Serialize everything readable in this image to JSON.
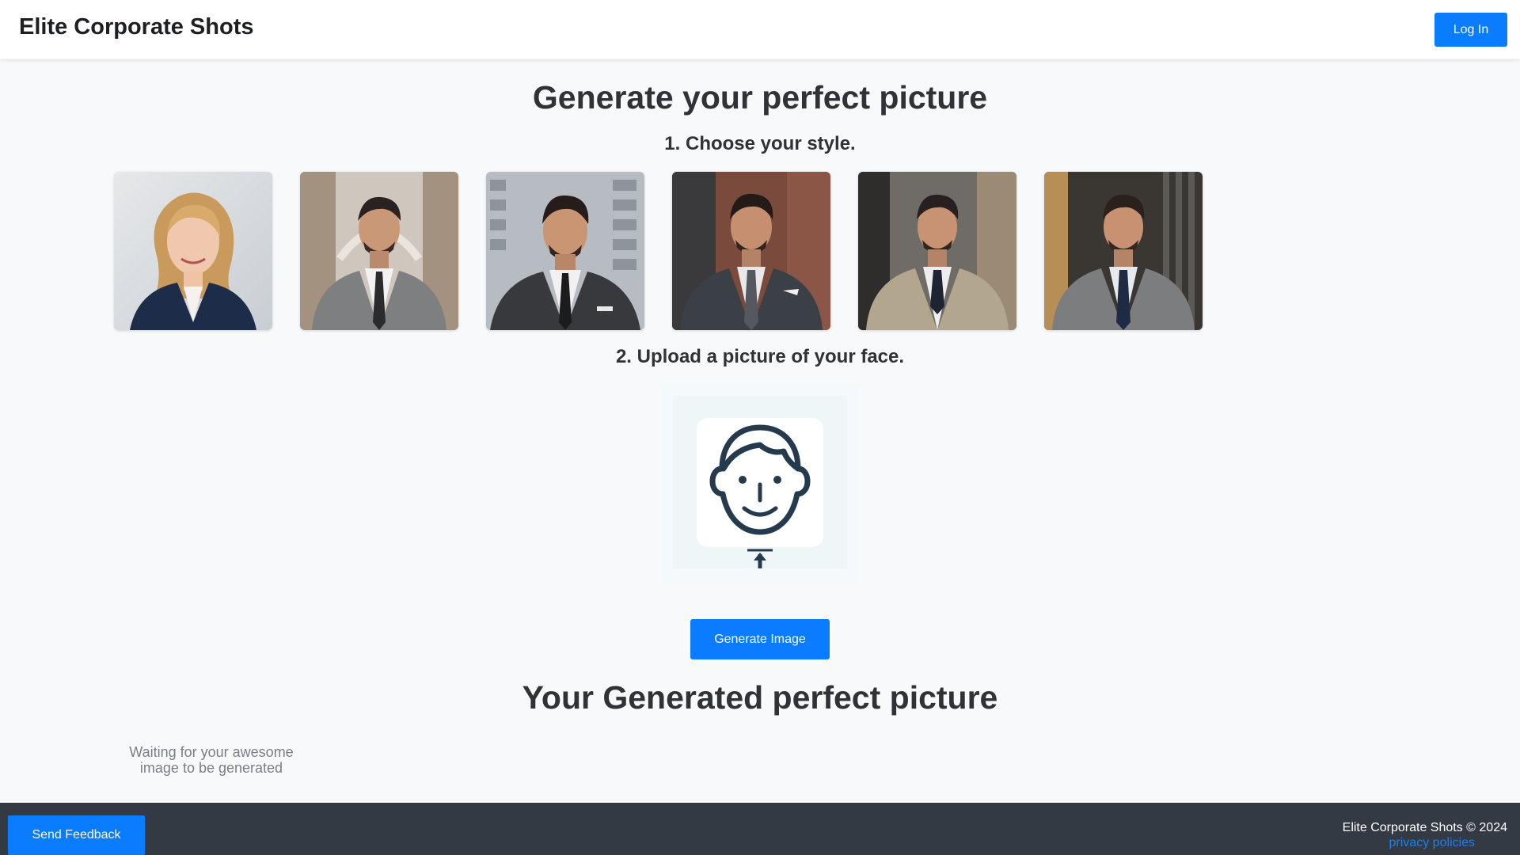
{
  "header": {
    "brand": "Elite Corporate Shots",
    "login_label": "Log In"
  },
  "main": {
    "title": "Generate your perfect picture",
    "step1": "1. Choose your style.",
    "step2": "2. Upload a picture of your face.",
    "styles": [
      {
        "name": "style-woman-navy-blazer"
      },
      {
        "name": "style-man-grey-suit-arch"
      },
      {
        "name": "style-man-charcoal-suit-building"
      },
      {
        "name": "style-man-dark-suit-brick"
      },
      {
        "name": "style-man-beige-suit-office"
      },
      {
        "name": "style-man-grey-suit-wood"
      }
    ],
    "upload_icon": "face-upload-icon",
    "generate_label": "Generate Image",
    "result_title": "Your Generated perfect picture",
    "waiting_text": "Waiting for your awesome image to be generated"
  },
  "footer": {
    "feedback_label": "Send Feedback",
    "copyright": "Elite Corporate Shots © 2024",
    "privacy_label": "privacy policies"
  },
  "colors": {
    "accent": "#0a7cff",
    "footer_bg": "#343a43",
    "page_bg": "#f8f9fb"
  }
}
